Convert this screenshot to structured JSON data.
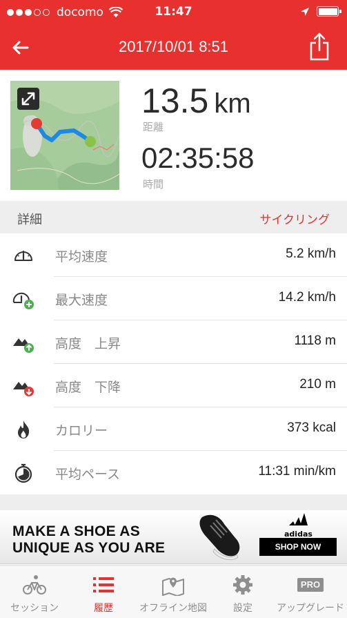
{
  "colors": {
    "accent": "#e8312f",
    "muted": "#888888"
  },
  "status_bar": {
    "carrier": "docomo",
    "time": "11:47",
    "signal_dots_filled": 3,
    "signal_dots_total": 5,
    "battery_level": 1.0
  },
  "nav": {
    "title": "2017/10/01 8:51",
    "back_icon": "back-arrow-icon",
    "share_icon": "share-icon"
  },
  "summary": {
    "distance_value": "13.5",
    "distance_unit": "km",
    "distance_label": "距離",
    "duration_value": "02:35:58",
    "duration_label": "時間"
  },
  "details": {
    "header": "詳細",
    "activity_type": "サイクリング",
    "rows": [
      {
        "icon": "speedometer-icon",
        "label": "平均速度",
        "value": "5.2 km/h"
      },
      {
        "icon": "speedometer-plus-icon",
        "label": "最大速度",
        "value": "14.2 km/h"
      },
      {
        "icon": "elevation-up-icon",
        "label": "高度　上昇",
        "value": "1118 m"
      },
      {
        "icon": "elevation-down-icon",
        "label": "高度　下降",
        "value": "210 m"
      },
      {
        "icon": "flame-icon",
        "label": "カロリー",
        "value": "373 kcal"
      },
      {
        "icon": "stopwatch-icon",
        "label": "平均ペース",
        "value": "11:31 min/km"
      }
    ]
  },
  "ad": {
    "headline_1": "MAKE A SHOE AS",
    "headline_2": "UNIQUE AS YOU ARE",
    "brand": "adidas",
    "cta": "SHOP NOW"
  },
  "tabs": [
    {
      "icon": "cyclist-icon",
      "label": "セッション",
      "active": false
    },
    {
      "icon": "list-icon",
      "label": "履歴",
      "active": true
    },
    {
      "icon": "map-pin-icon",
      "label": "オフライン地図",
      "active": false
    },
    {
      "icon": "gear-icon",
      "label": "設定",
      "active": false
    },
    {
      "icon": "pro-badge-icon",
      "label": "アップグレード",
      "badge": "PRO",
      "active": false
    }
  ]
}
